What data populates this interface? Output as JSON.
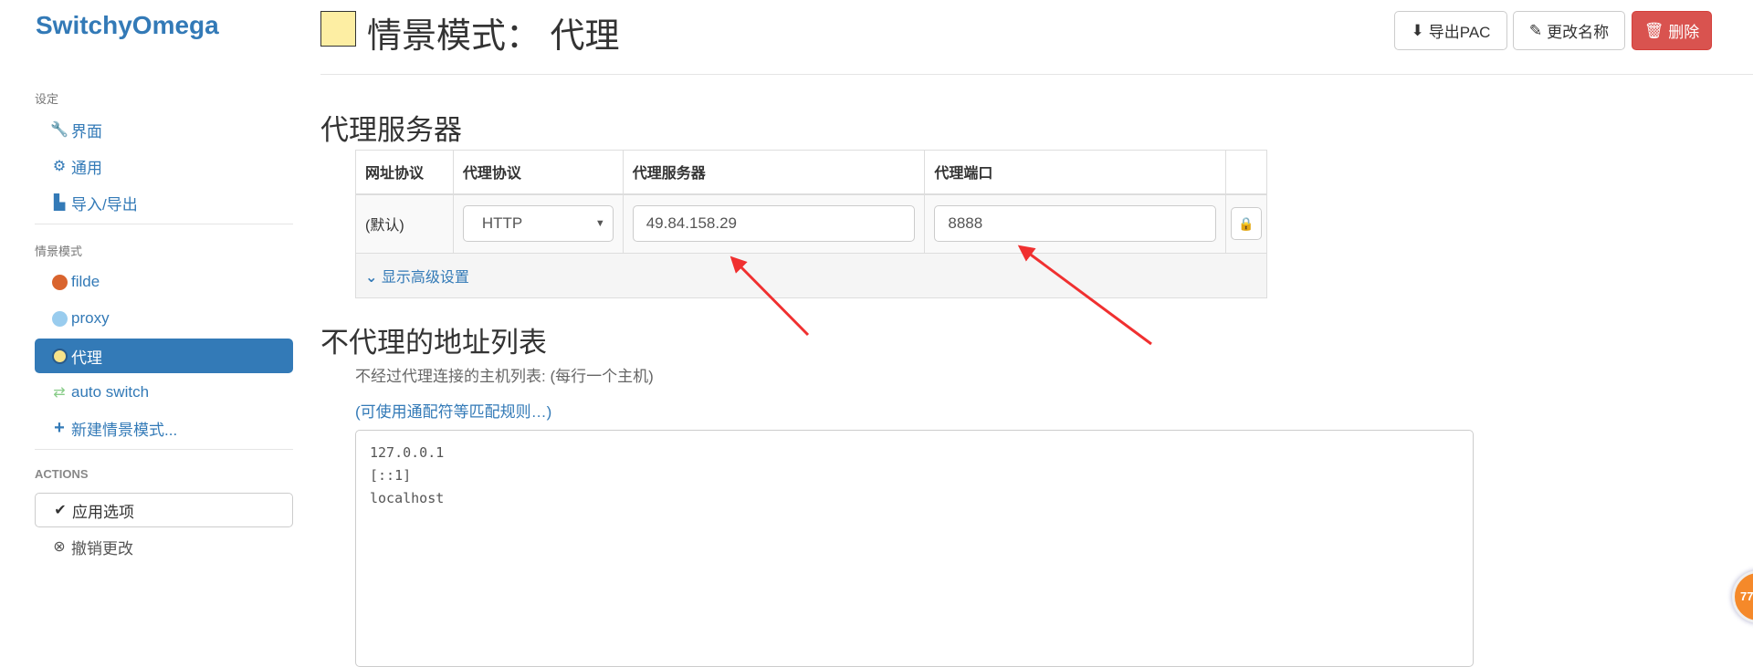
{
  "sidebar": {
    "logo": "SwitchyOmega",
    "settings_header": "设定",
    "settings_items": [
      {
        "label": "界面",
        "icon": "wrench-icon"
      },
      {
        "label": "通用",
        "icon": "gear-icon"
      },
      {
        "label": "导入/导出",
        "icon": "floppy-icon"
      }
    ],
    "profiles_header": "情景模式",
    "profiles": [
      {
        "label": "filde",
        "color": "#d9642e"
      },
      {
        "label": "proxy",
        "color": "#99ccee"
      },
      {
        "label": "代理",
        "color": "#f7e38a",
        "active": true
      },
      {
        "label": "auto switch",
        "color": "#99dd99"
      },
      {
        "label": "新建情景模式..."
      }
    ],
    "actions_header": "ACTIONS",
    "apply_label": "应用选项",
    "discard_label": "撤销更改"
  },
  "header": {
    "title": "情景模式： 代理",
    "profile_color": "#fdeea3",
    "export_pac": "导出PAC",
    "rename": "更改名称",
    "delete": "删除"
  },
  "proxy_section": {
    "title": "代理服务器",
    "columns": [
      "网址协议",
      "代理协议",
      "代理服务器",
      "代理端口"
    ],
    "row": {
      "scheme": "(默认)",
      "protocol": "HTTP",
      "server": "49.84.158.29",
      "port": "8888"
    },
    "advanced_label": "显示高级设置"
  },
  "bypass_section": {
    "title": "不代理的地址列表",
    "description": "不经过代理连接的主机列表: (每行一个主机)",
    "wildcard_link": "(可使用通配符等匹配规则…)",
    "bypass_list": "127.0.0.1\n[::1]\nlocalhost"
  },
  "badge": {
    "text": "77",
    "color": "#f5892a"
  },
  "colors": {
    "primary": "#337ab7",
    "danger": "#d9534f",
    "annotation_arrow": "#f03030"
  }
}
